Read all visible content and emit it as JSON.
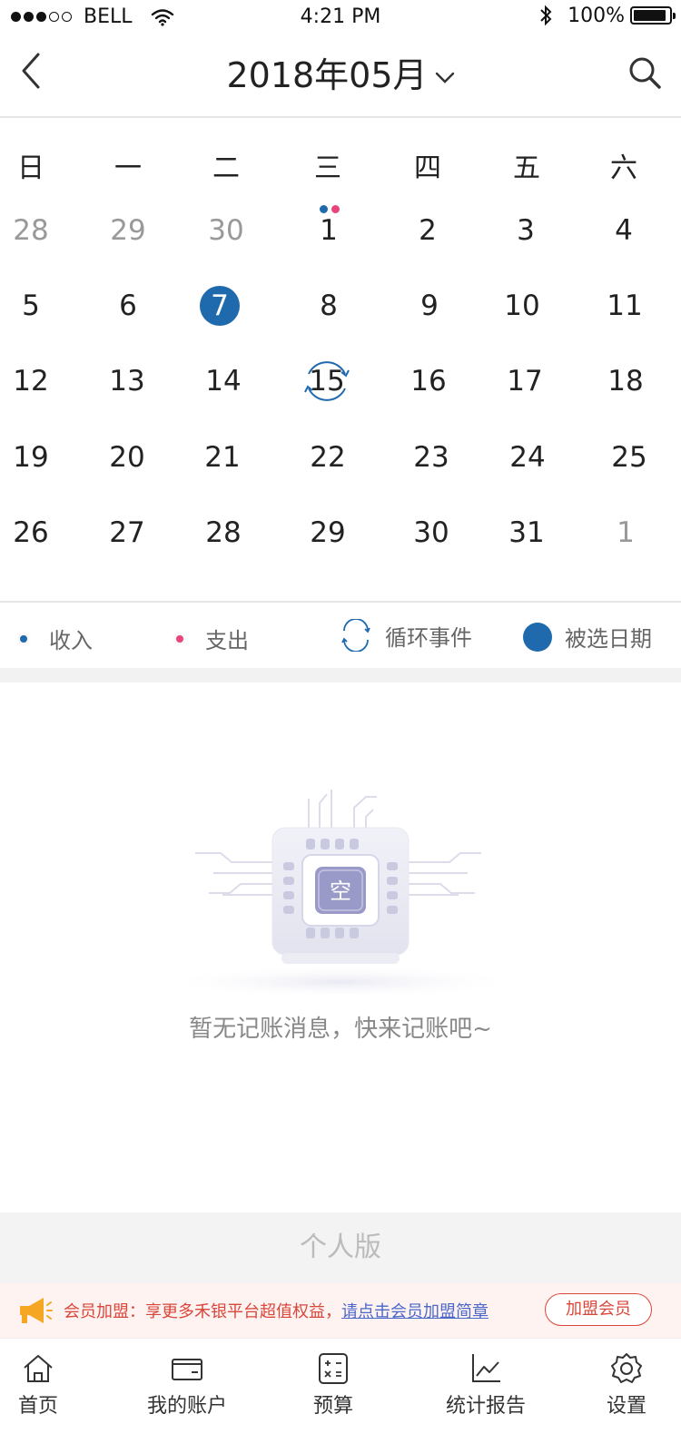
{
  "status_bar": {
    "carrier": "BELL",
    "time": "4:21 PM",
    "battery": "100%"
  },
  "nav": {
    "title": "2018年05月"
  },
  "weekdays": [
    "日",
    "一",
    "二",
    "三",
    "四",
    "五",
    "六"
  ],
  "calendar": {
    "weeks": [
      [
        "28",
        "29",
        "30",
        "1",
        "2",
        "3",
        "4"
      ],
      [
        "5",
        "6",
        "7",
        "8",
        "9",
        "10",
        "11"
      ],
      [
        "12",
        "13",
        "14",
        "15",
        "16",
        "17",
        "18"
      ],
      [
        "19",
        "20",
        "21",
        "22",
        "23",
        "24",
        "25"
      ],
      [
        "26",
        "27",
        "28",
        "29",
        "30",
        "31",
        "1"
      ]
    ],
    "selected_day": "7",
    "recurring_day": "15",
    "marked_day": "1"
  },
  "legend": {
    "income": "收入",
    "expense": "支出",
    "recurring": "循环事件",
    "selected": "被选日期"
  },
  "empty": {
    "badge": "空",
    "message": "暂无记账消息，快来记账吧~"
  },
  "edition": "个人版",
  "member": {
    "text": "会员加盟：享更多禾银平台超值权益，",
    "link": "请点击会员加盟简章",
    "button": "加盟会员"
  },
  "tabs": [
    {
      "label": "首页",
      "icon": "home-icon"
    },
    {
      "label": "我的账户",
      "icon": "wallet-icon"
    },
    {
      "label": "预算",
      "icon": "calculator-icon"
    },
    {
      "label": "统计报告",
      "icon": "chart-icon"
    },
    {
      "label": "设置",
      "icon": "gear-icon"
    }
  ],
  "colors": {
    "primary": "#1f6aad",
    "income": "#1f6aad",
    "expense": "#e8457a",
    "member_red": "#d9463a",
    "link_blue": "#4a67c9"
  }
}
